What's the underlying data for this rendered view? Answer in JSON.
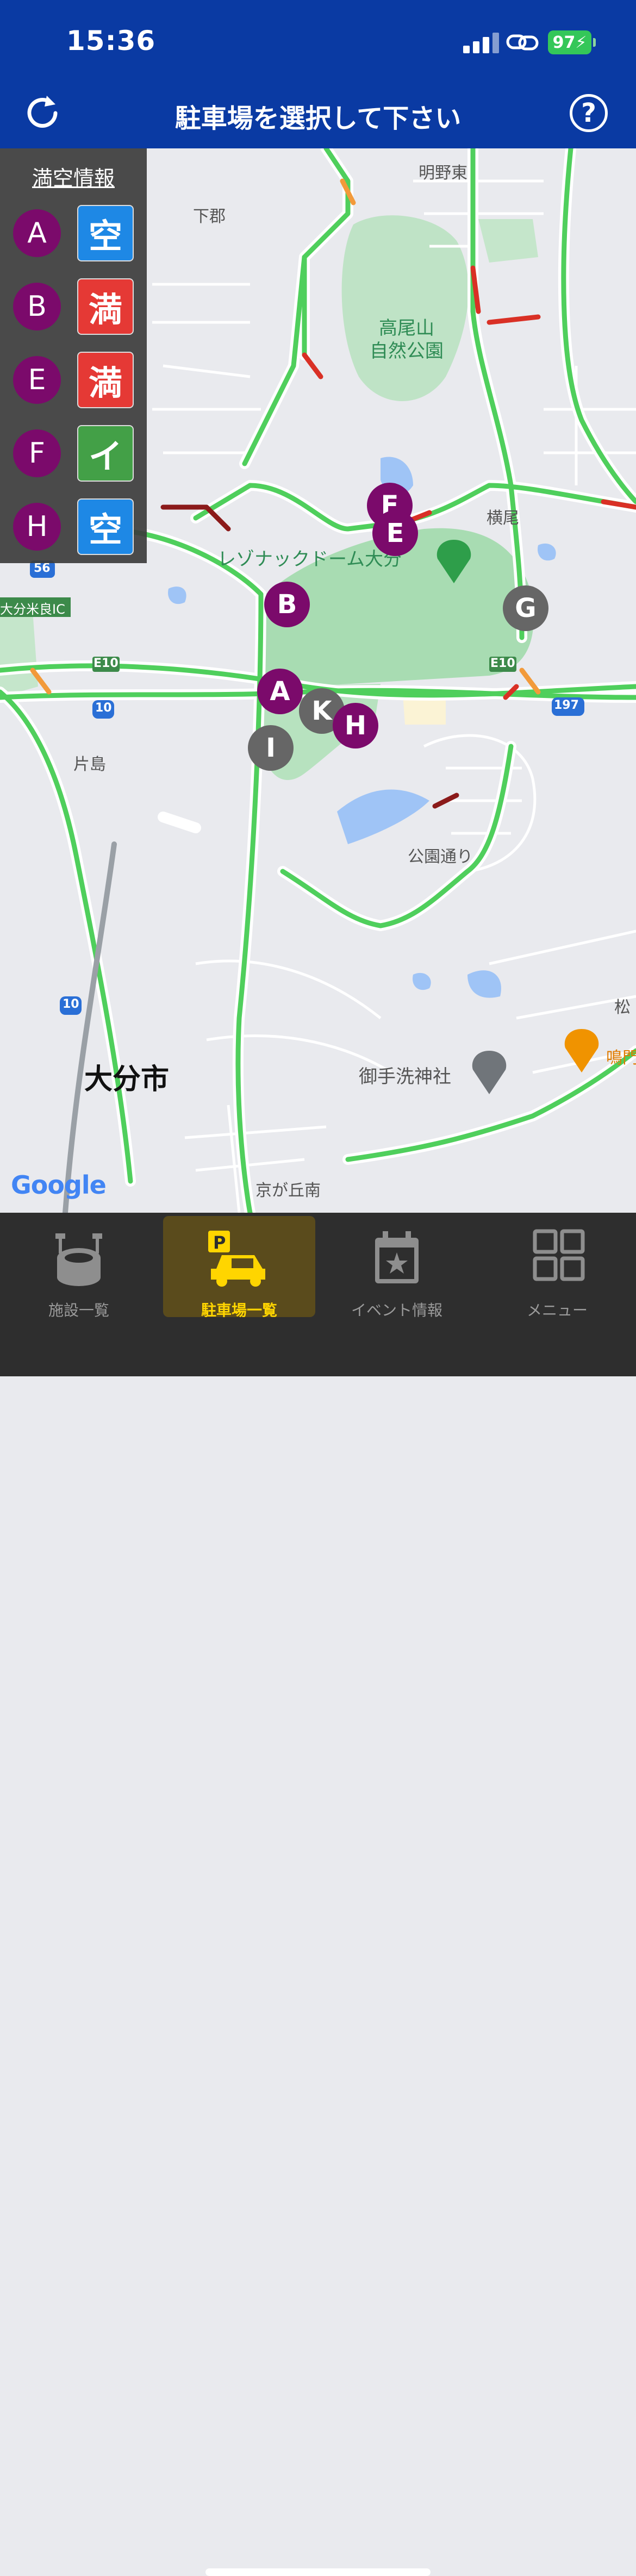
{
  "status_bar": {
    "time": "15:36",
    "battery": "97"
  },
  "header": {
    "title": "駐車場を選択して下さい",
    "refresh_icon": "refresh-icon",
    "help_label": "?"
  },
  "availability_panel": {
    "title": "満空情報",
    "rows": [
      {
        "lot": "A",
        "status": "空",
        "color": "#1e88e5"
      },
      {
        "lot": "B",
        "status": "満",
        "color": "#e53935"
      },
      {
        "lot": "E",
        "status": "満",
        "color": "#e53935"
      },
      {
        "lot": "F",
        "status": "イ",
        "color": "#43a047"
      },
      {
        "lot": "H",
        "status": "空",
        "color": "#1e88e5"
      }
    ]
  },
  "map": {
    "labels": {
      "akenohigashi": "明野東",
      "shimogori": "下郡",
      "takaoyama": "高尾山\n自然公園",
      "yokoo": "横尾",
      "stadium": "レゾナックドーム大分",
      "yonera_ic": "大分米良IC",
      "katashima": "片島",
      "koendori": "公園通り",
      "oita_city": "大分市",
      "mitarai": "御手洗神社",
      "kyogaoka": "京が丘南",
      "matsu": "松",
      "naru": "鳴門",
      "route_e10_a": "E10",
      "route_e10_b": "E10",
      "route_10_a": "10",
      "route_10_b": "10",
      "route_197": "197",
      "route_56": "56"
    },
    "markers": [
      "F",
      "E",
      "B",
      "G",
      "A",
      "K",
      "H",
      "I"
    ],
    "attribution": "Google"
  },
  "tabs": [
    {
      "label": "施設一覧",
      "icon": "stadium-icon",
      "active": false
    },
    {
      "label": "駐車場一覧",
      "icon": "parking-car-icon",
      "active": true
    },
    {
      "label": "イベント情報",
      "icon": "calendar-star-icon",
      "active": false
    },
    {
      "label": "メニュー",
      "icon": "grid-menu-icon",
      "active": false
    }
  ]
}
